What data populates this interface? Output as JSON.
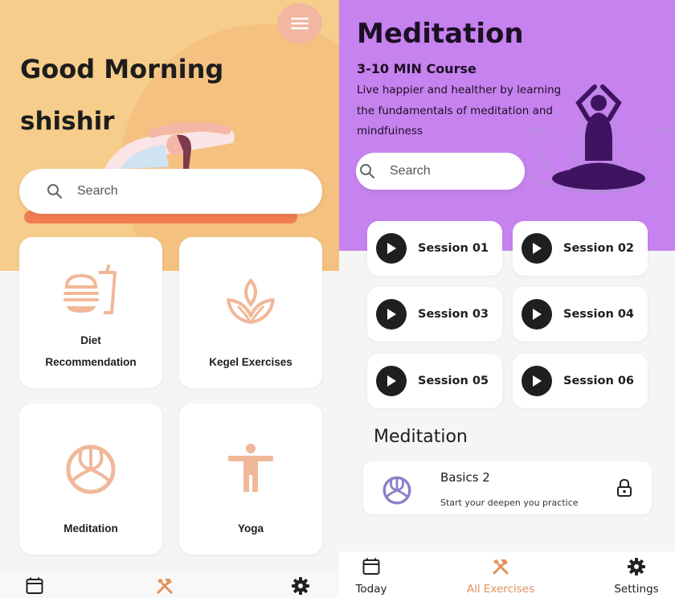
{
  "left": {
    "greeting": "Good Morning",
    "user_name": "shishir",
    "menu_icon": "hamburger-icon",
    "search": {
      "placeholder": "Search",
      "icon": "search-icon"
    },
    "cards": [
      {
        "label_line1": "Diet",
        "label_line2": "Recommendation",
        "icon": "burger-drink-icon"
      },
      {
        "label": "Kegel Exercises",
        "icon": "lotus-icon"
      },
      {
        "label": "Meditation",
        "icon": "volleyball-icon"
      },
      {
        "label": "Yoga",
        "icon": "person-stretch-icon"
      }
    ],
    "nav": [
      {
        "icon": "calendar-icon"
      },
      {
        "icon": "tools-icon"
      },
      {
        "icon": "gear-icon"
      }
    ]
  },
  "right": {
    "title": "Meditation",
    "course": "3-10 MIN Course",
    "description": "Live happier and healther by learning the fundamentals of meditation and mindfuiness",
    "search": {
      "placeholder": "Search",
      "icon": "search-icon"
    },
    "sessions": [
      "Session 01",
      "Session 02",
      "Session 03",
      "Session 04",
      "Session 05",
      "Session 06"
    ],
    "section_title": "Meditation",
    "basics": {
      "title": "Basics 2",
      "subtitle": "Start your deepen you practice",
      "icon": "volleyball-icon",
      "lock_icon": "lock-icon"
    },
    "nav": [
      {
        "label": "Today",
        "icon": "calendar-icon"
      },
      {
        "label": "All Exercises",
        "icon": "tools-icon"
      },
      {
        "label": "Settings",
        "icon": "gear-icon"
      }
    ]
  },
  "colors": {
    "left_header": "#f6cd8a",
    "accent_orange": "#e0915a",
    "right_header": "#c682ee",
    "icon_peach": "#f0b898",
    "meditation_purple": "#8b7fc9"
  }
}
